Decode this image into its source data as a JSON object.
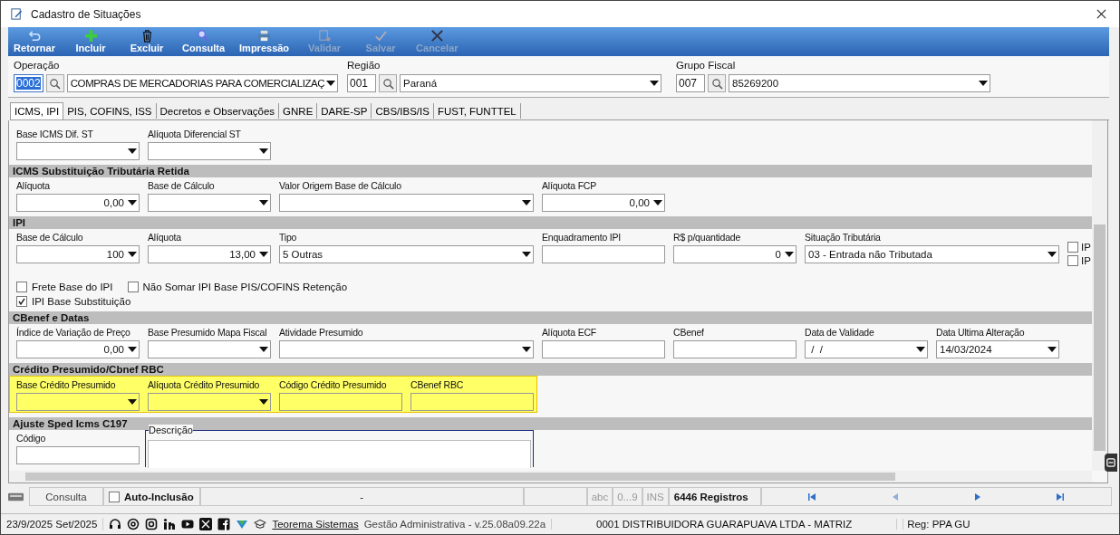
{
  "window": {
    "title": "Cadastro de Situações"
  },
  "toolbar": [
    {
      "label": "Retornar",
      "disabled": false
    },
    {
      "label": "Incluir",
      "disabled": false
    },
    {
      "label": "Excluir",
      "disabled": false
    },
    {
      "label": "Consulta",
      "disabled": false
    },
    {
      "label": "Impressão",
      "disabled": false
    },
    {
      "label": "Validar",
      "disabled": true
    },
    {
      "label": "Salvar",
      "disabled": true
    },
    {
      "label": "Cancelar",
      "disabled": true
    }
  ],
  "header": [
    {
      "label": "Operação",
      "code": "0002",
      "code_selected": true,
      "value": "COMPRAS DE MERCADORIAS PARA COMERCIALIZAÇ"
    },
    {
      "label": "Região",
      "code": "001",
      "code_selected": false,
      "value": "Paraná"
    },
    {
      "label": "Grupo Fiscal",
      "code": "007",
      "code_selected": false,
      "value": "85269200"
    }
  ],
  "tabs": [
    {
      "label": "ICMS, IPI",
      "selected": true
    },
    {
      "label": "PIS, COFINS, ISS",
      "selected": false
    },
    {
      "label": "Decretos e Observações",
      "selected": false
    },
    {
      "label": "GNRE",
      "selected": false
    },
    {
      "label": "DARE-SP",
      "selected": false
    },
    {
      "label": "CBS/IBS/IS",
      "selected": false
    },
    {
      "label": "FUST, FUNTTEL",
      "selected": false
    }
  ],
  "sections": [
    {
      "fields": [
        {
          "label": "Base ICMS Dif. ST",
          "kind": "combo"
        },
        {
          "label": "Alíquota Diferencial ST",
          "kind": "combo"
        }
      ]
    },
    {
      "title": "ICMS Substituição Tributária Retida",
      "fields": [
        {
          "label": "Alíquota",
          "kind": "number",
          "value": "0,00"
        },
        {
          "label": "Base de Cálculo",
          "kind": "combo"
        },
        {
          "label": "Valor Origem Base de Cálculo",
          "kind": "combo_wide"
        },
        {
          "label": "Alíquota FCP",
          "kind": "number",
          "value": "0,00"
        }
      ]
    },
    {
      "title": "IPI",
      "fields": [
        {
          "label": "Base de Cálculo",
          "kind": "number",
          "value": "100"
        },
        {
          "label": "Alíquota",
          "kind": "number",
          "value": "13,00"
        },
        {
          "label": "Tipo",
          "kind": "combo_wide",
          "value": "5 Outras"
        },
        {
          "label": "Enquadramento IPI",
          "kind": "text"
        },
        {
          "label": "R$ p/quantidade",
          "kind": "number",
          "value": "0"
        },
        {
          "label": "Situação Tributária",
          "kind": "combo_wide",
          "value": "03 - Entrada não Tributada"
        }
      ],
      "side_checks": [
        {
          "label": "IP",
          "checked": false
        },
        {
          "label": "IP",
          "checked": false
        }
      ],
      "check_rows": [
        [
          {
            "label": "Frete Base do IPI",
            "checked": false
          },
          {
            "label": "Não Somar IPI Base PIS/COFINS Retenção",
            "checked": false
          }
        ],
        [
          {
            "label": "IPI Base Substituição",
            "checked": true
          }
        ]
      ]
    },
    {
      "title": "CBenef e Datas",
      "fields": [
        {
          "label": "Índice de Variação de Preço",
          "kind": "number",
          "value": "0,00"
        },
        {
          "label": "Base Presumido Mapa Fiscal",
          "kind": "combo"
        },
        {
          "label": "Atividade Presumido",
          "kind": "combo_wide"
        },
        {
          "label": "Alíquota ECF",
          "kind": "text"
        },
        {
          "label": "CBenef",
          "kind": "text"
        },
        {
          "label": "Data de Validade",
          "kind": "combo",
          "value": " /  /"
        },
        {
          "label": "Data Ultima Alteração",
          "kind": "combo",
          "value": "14/03/2024"
        }
      ]
    },
    {
      "title": "Crédito Presumido/Cbnef RBC",
      "highlighted": true,
      "fields": [
        {
          "label": "Base Crédito Presumido",
          "kind": "combo"
        },
        {
          "label": "Alíquota Crédito Presumido",
          "kind": "combo"
        },
        {
          "label": "Código Crédito Presumido",
          "kind": "text"
        },
        {
          "label": "CBenef RBC",
          "kind": "text"
        }
      ]
    },
    {
      "title": "Ajuste Sped Icms C197",
      "fields": [
        {
          "label": "Código",
          "kind": "text"
        },
        {
          "label": "Descrição",
          "kind": "memo"
        }
      ]
    }
  ],
  "status_bar": {
    "mode": "Consulta",
    "auto_inclusion": {
      "label": "Auto-Inclusão",
      "checked": false
    },
    "field": "-",
    "abc": "abc",
    "digits": "0...9",
    "ins": "INS",
    "records": "6446 Registros"
  },
  "footer": {
    "date": "23/9/2025 Set/2025",
    "link": "Teorema Sistemas",
    "version": "Gestão Administrativa - v.25.08a09.22a",
    "company": "0001 DISTRIBUIDORA GUARAPUAVA LTDA - MATRIZ",
    "reg": "Reg: PPA GU"
  }
}
